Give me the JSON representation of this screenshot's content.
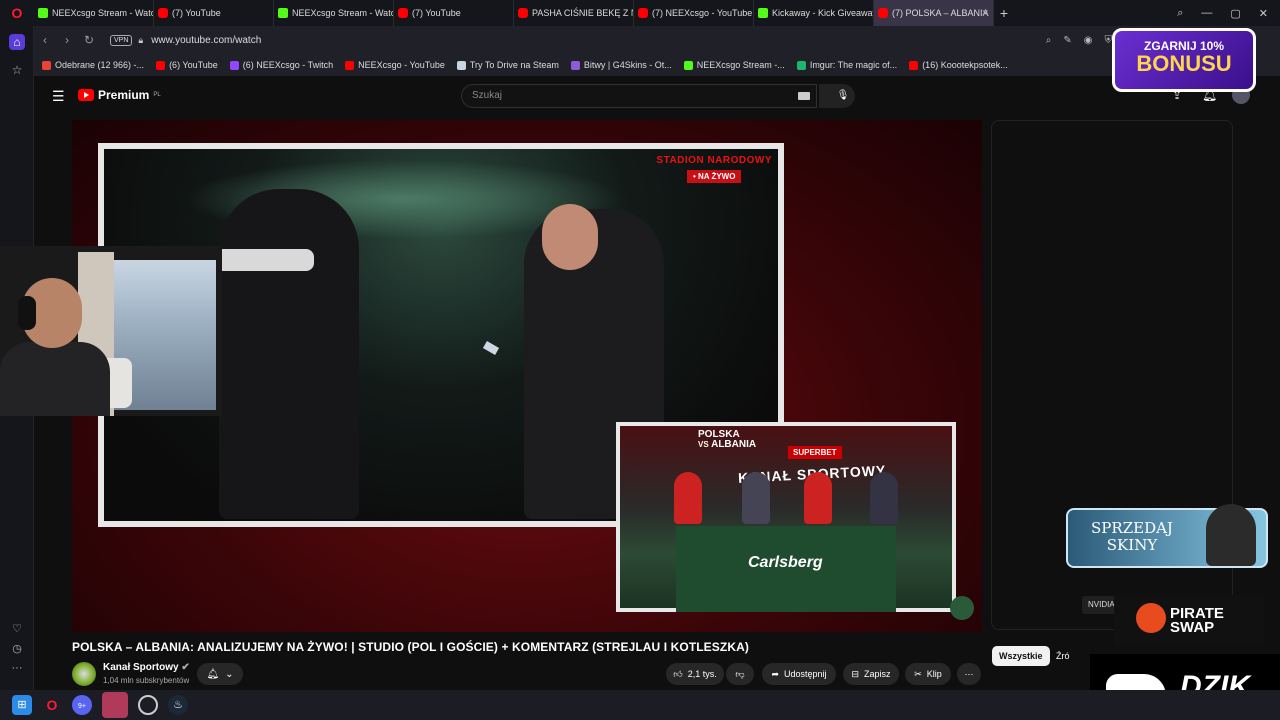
{
  "browser": {
    "tabs": [
      {
        "label": "NEEXcsgo Stream - Watch",
        "icon": "kick-icon",
        "active": false
      },
      {
        "label": "(7) YouTube",
        "icon": "youtube-icon",
        "active": false
      },
      {
        "label": "NEEXcsgo Stream - Watch",
        "icon": "kick-icon",
        "active": false
      },
      {
        "label": "(7) YouTube",
        "icon": "youtube-icon",
        "active": false
      },
      {
        "label": "PASHA CIŚNIE BEKĘ Z NIK",
        "icon": "youtube-icon",
        "active": false
      },
      {
        "label": "(7) NEEXcsgo - YouTube",
        "icon": "youtube-icon",
        "active": false
      },
      {
        "label": "Kickaway - Kick Giveaway",
        "icon": "kick-icon",
        "active": false
      },
      {
        "label": "(7) POLSKA – ALBANIA",
        "icon": "youtube-icon",
        "active": true
      }
    ],
    "url": "www.youtube.com/watch",
    "vpn_label": "VPN",
    "bookmarks": [
      {
        "label": "Odebrane (12 966) -...",
        "color": "#ea4335"
      },
      {
        "label": "(6) YouTube",
        "color": "#ff0000"
      },
      {
        "label": "(6) NEEXcsgo - Twitch",
        "color": "#9146ff"
      },
      {
        "label": "NEEXcsgo - YouTube",
        "color": "#ff0000"
      },
      {
        "label": "Try To Drive na Steam",
        "color": "#c7d5e0"
      },
      {
        "label": "Bitwy | G4Skins - Ot...",
        "color": "#8e5bd6"
      },
      {
        "label": "NEEXcsgo Stream -...",
        "color": "#53fc18"
      },
      {
        "label": "Imgur: The magic of...",
        "color": "#1bb76e"
      },
      {
        "label": "(16) Koootekpsotek...",
        "color": "#ff0000"
      }
    ]
  },
  "youtube": {
    "logo_text": "Premium",
    "logo_region": "PL",
    "search_placeholder": "Szukaj",
    "video": {
      "overlay_badge_line1": "STADION NARODOWY",
      "overlay_badge_line2": "• NA ŻYWO",
      "pip_title_line1": "POLSKA",
      "pip_title_vs": "VS",
      "pip_title_line2": "ALBANIA",
      "pip_sponsor": "SUPERBET",
      "pip_show": "KANAŁ SPORTOWY",
      "pip_desk_brand": "Carlsberg"
    },
    "title": "POLSKA – ALBANIA: ANALIZUJEMY NA ŻYWO! | STUDIO (POL I GOŚCIE) + KOMENTARZ (STREJLAU I KOTLESZKA)",
    "channel": {
      "name": "Kanał Sportowy",
      "subscribers": "1,04 mln subskrybentów"
    },
    "actions": {
      "likes": "2,1 tys.",
      "share": "Udostępnij",
      "save": "Zapisz",
      "clip": "Klip"
    },
    "filters": {
      "all": "Wszystkie",
      "second": "Źró"
    }
  },
  "overlays": {
    "bonus_line1": "ZGARNIJ 10%",
    "bonus_line2": "BONUSU",
    "skiny_line1": "SPRZEDAJ",
    "skiny_line2": "SKINY",
    "nvidia": "NVIDIA",
    "pirate_line1": "PIRATE",
    "pirate_line2": "SWAP",
    "dzik": "DZIK"
  },
  "taskbar": {
    "discord_badge": "9+"
  }
}
